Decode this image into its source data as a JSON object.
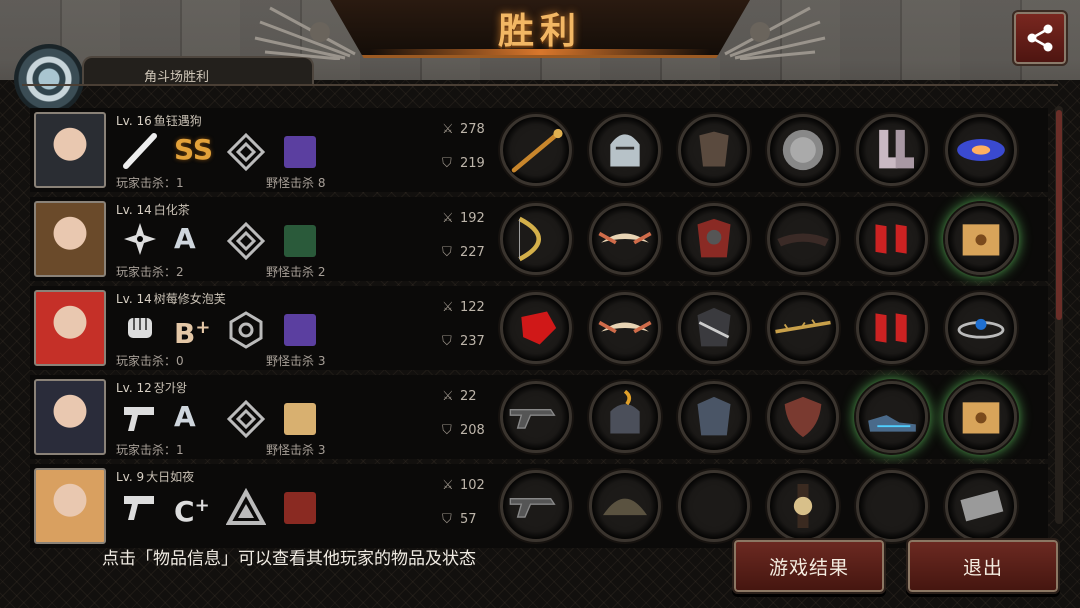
{
  "title": "胜利",
  "top_tab_label": "角斗场胜利",
  "hint_text": "点击「物品信息」可以查看其他玩家的物品及状态",
  "buttons": {
    "result": "游戏结果",
    "exit": "退出"
  },
  "colors": {
    "accent": "#f2b764",
    "button": "#6d2a22",
    "grade_ss": "#e3a23a"
  },
  "players": [
    {
      "level": "Lv. 16",
      "name": "鱼钰遇狗",
      "grade": "SS",
      "grade_sup": "",
      "weapon_icon": "bat-icon",
      "class_icon": "diamond-rank-icon",
      "player_kills": "玩家击杀：1",
      "monster_kills": "野怪击杀 8",
      "attack": "278",
      "defense": "219",
      "items": [
        "wand-icon",
        "knight-helmet-icon",
        "leather-armor-icon",
        "round-shield-icon",
        "boots-icon",
        "galaxy-orb-icon"
      ]
    },
    {
      "level": "Lv. 14",
      "name": "白化茶",
      "grade": "A",
      "grade_sup": "",
      "weapon_icon": "shuriken-icon",
      "class_icon": "diamond-rank-icon",
      "player_kills": "玩家击杀：2",
      "monster_kills": "野怪击杀 2",
      "attack": "192",
      "defense": "227",
      "items": [
        "bow-icon",
        "winged-tiara-icon",
        "red-armor-icon",
        "visor-icon",
        "red-heels-icon",
        "treasure-box-icon"
      ]
    },
    {
      "level": "Lv. 14",
      "name": "树莓修女泡芙",
      "grade": "B",
      "grade_sup": "+",
      "weapon_icon": "fist-icon",
      "class_icon": "hexagon-rank-icon",
      "player_kills": "玩家击杀：0",
      "monster_kills": "野怪击杀 3",
      "attack": "122",
      "defense": "237",
      "items": [
        "red-gauntlet-icon",
        "winged-tiara-icon",
        "dark-armor-icon",
        "thorn-vine-icon",
        "red-heels-icon",
        "gem-bracelet-icon"
      ]
    },
    {
      "level": "Lv. 12",
      "name": "장가왕",
      "grade": "A",
      "grade_sup": "",
      "weapon_icon": "pistol-icon",
      "class_icon": "diamond-rank-icon",
      "player_kills": "玩家击杀：1",
      "monster_kills": "野怪击杀 3",
      "attack": "22",
      "defense": "208",
      "items": [
        "revolver-icon",
        "plumed-helmet-icon",
        "plate-armor-icon",
        "kite-shield-icon",
        "sneakers-icon",
        "treasure-box-icon"
      ]
    },
    {
      "level": "Lv. 9",
      "name": "大日如夜",
      "grade": "C",
      "grade_sup": "+",
      "weapon_icon": "pistol-icon",
      "class_icon": "triangle-rank-icon",
      "player_kills": "",
      "monster_kills": "",
      "attack": "102",
      "defense": "57",
      "items": [
        "revolver-icon",
        "army-helmet-icon",
        "empty-slot",
        "wristwatch-icon",
        "empty-slot",
        "ammo-clip-icon"
      ]
    }
  ]
}
